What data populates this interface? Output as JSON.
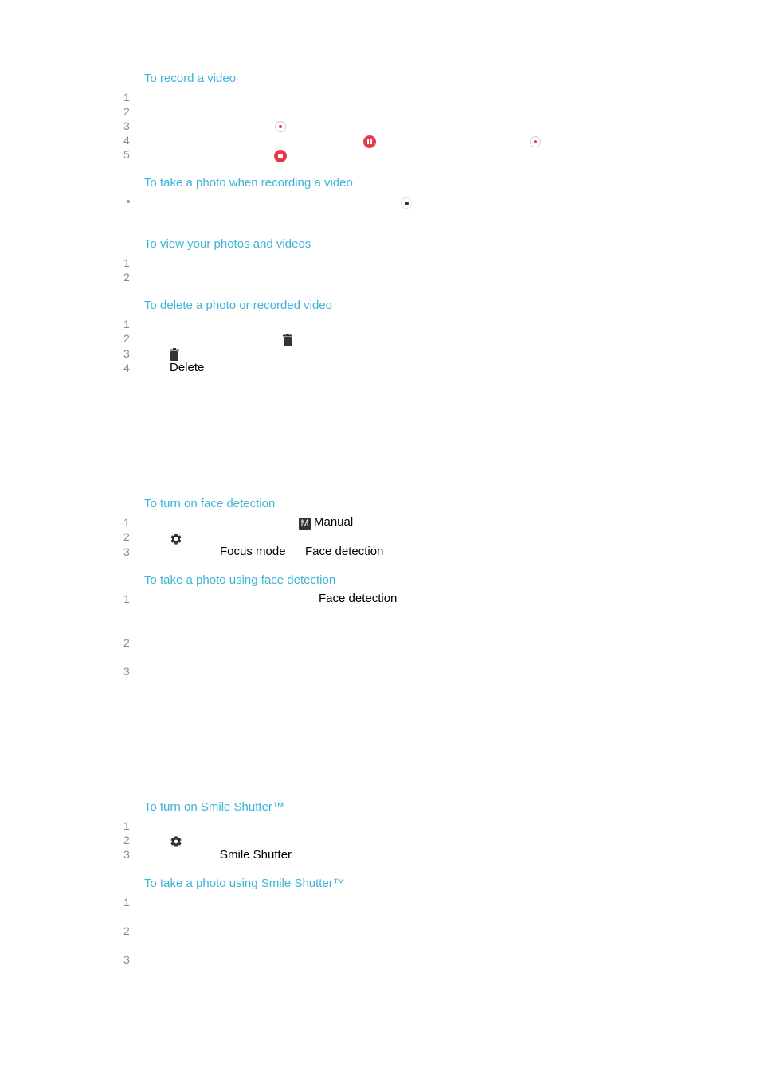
{
  "colors": {
    "heading": "#3cb4d8",
    "step_number": "#8a8a8a",
    "record_red": "#e8394a",
    "icon_dark": "#333333"
  },
  "sections": [
    {
      "title": "To record a video",
      "steps": [
        "1",
        "2",
        "3",
        "4",
        "5"
      ],
      "icons": [
        "record-icon",
        "pause-icon",
        "record-icon",
        "stop-icon"
      ]
    },
    {
      "title": "To take a photo when recording a video",
      "bullet": "•",
      "icons": [
        "camera-icon"
      ]
    },
    {
      "title": "To view your photos and videos",
      "steps": [
        "1",
        "2"
      ]
    },
    {
      "title": "To delete a photo or recorded video",
      "steps": [
        "1",
        "2",
        "3",
        "4"
      ],
      "icons": [
        "trash-icon",
        "trash-icon"
      ],
      "labels": {
        "delete": "Delete"
      }
    },
    {
      "title": "To turn on face detection",
      "steps": [
        "1",
        "2",
        "3"
      ],
      "icons": [
        "manual-mode-icon",
        "gear-icon"
      ],
      "labels": {
        "manual_badge": "M",
        "manual": "Manual",
        "focus_mode": "Focus mode",
        "face_detection": "Face detection"
      }
    },
    {
      "title": "To take a photo using face detection",
      "steps": [
        "1",
        "2",
        "3"
      ],
      "labels": {
        "face_detection": "Face detection"
      }
    },
    {
      "title": "To turn on Smile Shutter™",
      "steps": [
        "1",
        "2",
        "3"
      ],
      "icons": [
        "gear-icon"
      ],
      "labels": {
        "smile_shutter": "Smile Shutter"
      }
    },
    {
      "title": "To take a photo using Smile Shutter™",
      "steps": [
        "1",
        "2",
        "3"
      ]
    }
  ]
}
